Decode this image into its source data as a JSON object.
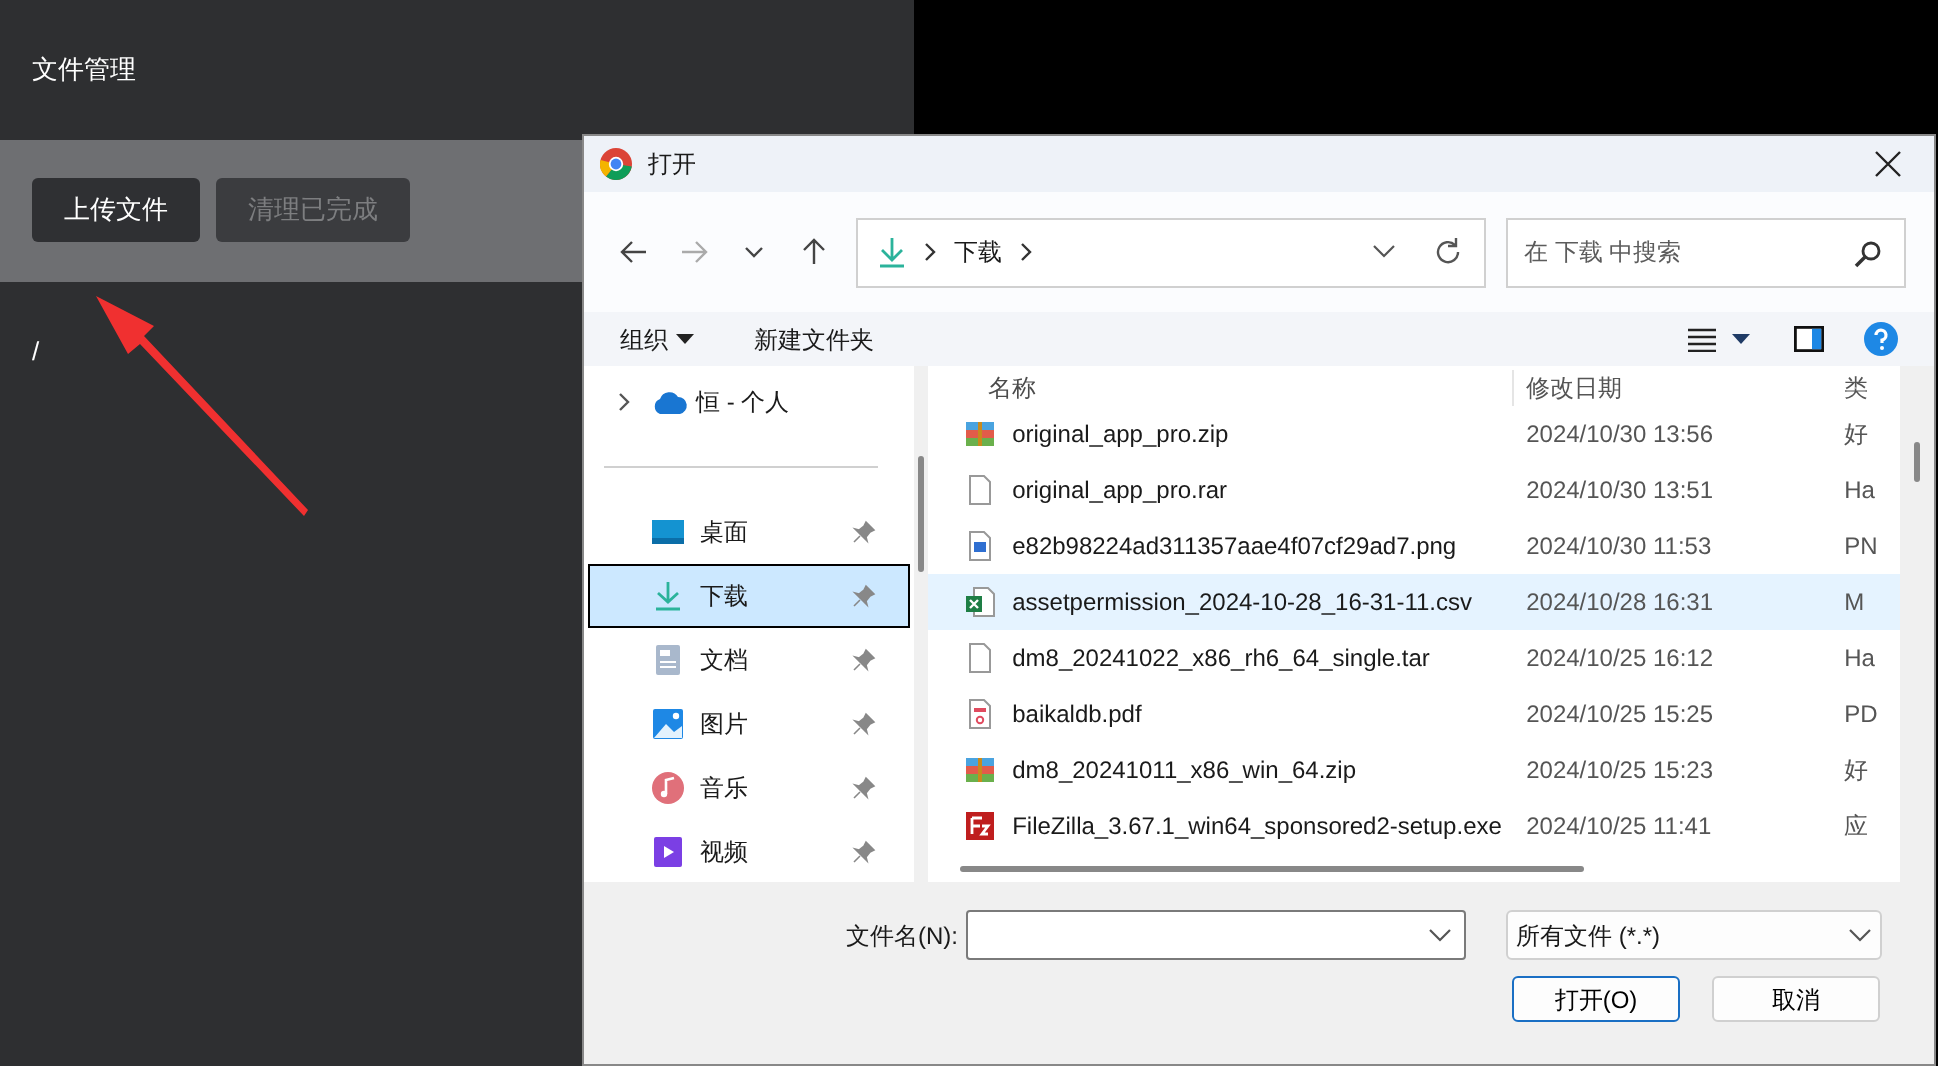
{
  "app": {
    "title": "文件管理",
    "path": "/",
    "buttons": [
      {
        "label": "上传文件",
        "disabled": false
      },
      {
        "label": "清理已完成",
        "disabled": true
      }
    ]
  },
  "dialog": {
    "title": "打开",
    "address": {
      "segments": [
        "下载"
      ]
    },
    "search": {
      "placeholder": "在 下载 中搜索"
    },
    "toolbar": {
      "organize": "组织",
      "new_folder": "新建文件夹"
    },
    "sidebar": {
      "cloud": {
        "label": "恒 - 个人",
        "expanded": false
      },
      "items": [
        {
          "label": "桌面",
          "kind": "desktop",
          "selected": false
        },
        {
          "label": "下载",
          "kind": "download",
          "selected": true
        },
        {
          "label": "文档",
          "kind": "documents",
          "selected": false
        },
        {
          "label": "图片",
          "kind": "pictures",
          "selected": false
        },
        {
          "label": "音乐",
          "kind": "music",
          "selected": false
        },
        {
          "label": "视频",
          "kind": "videos",
          "selected": false
        }
      ]
    },
    "files": {
      "columns": [
        "名称",
        "修改日期",
        "类"
      ],
      "rows": [
        {
          "name": "original_app_pro.zip",
          "date": "2024/10/30 13:56",
          "column_3": "好",
          "kind": "archive",
          "selected": false
        },
        {
          "name": "original_app_pro.rar",
          "date": "2024/10/30 13:51",
          "column_3": "Ha",
          "kind": "blank",
          "selected": false
        },
        {
          "name": "e82b98224ad311357aae4f07cf29ad7.png",
          "date": "2024/10/30 11:53",
          "column_3": "PN",
          "kind": "image",
          "selected": false
        },
        {
          "name": "assetpermission_2024-10-28_16-31-11.csv",
          "date": "2024/10/28 16:31",
          "column_3": "M",
          "kind": "spreadsheet",
          "selected": true
        },
        {
          "name": "dm8_20241022_x86_rh6_64_single.tar",
          "date": "2024/10/25 16:12",
          "column_3": "Ha",
          "kind": "blank",
          "selected": false
        },
        {
          "name": "baikaldb.pdf",
          "date": "2024/10/25 15:25",
          "column_3": "PD",
          "kind": "pdf",
          "selected": false
        },
        {
          "name": "dm8_20241011_x86_win_64.zip",
          "date": "2024/10/25 15:23",
          "column_3": "好",
          "kind": "archive",
          "selected": false
        },
        {
          "name": "FileZilla_3.67.1_win64_sponsored2-setup.exe",
          "date": "2024/10/25 11:41",
          "column_3": "应",
          "kind": "exe",
          "selected": false
        }
      ]
    },
    "filename": {
      "label": "文件名(N):"
    },
    "filetype": "所有文件 (*.*)",
    "buttons": [
      "打开(O)",
      "取消"
    ]
  }
}
